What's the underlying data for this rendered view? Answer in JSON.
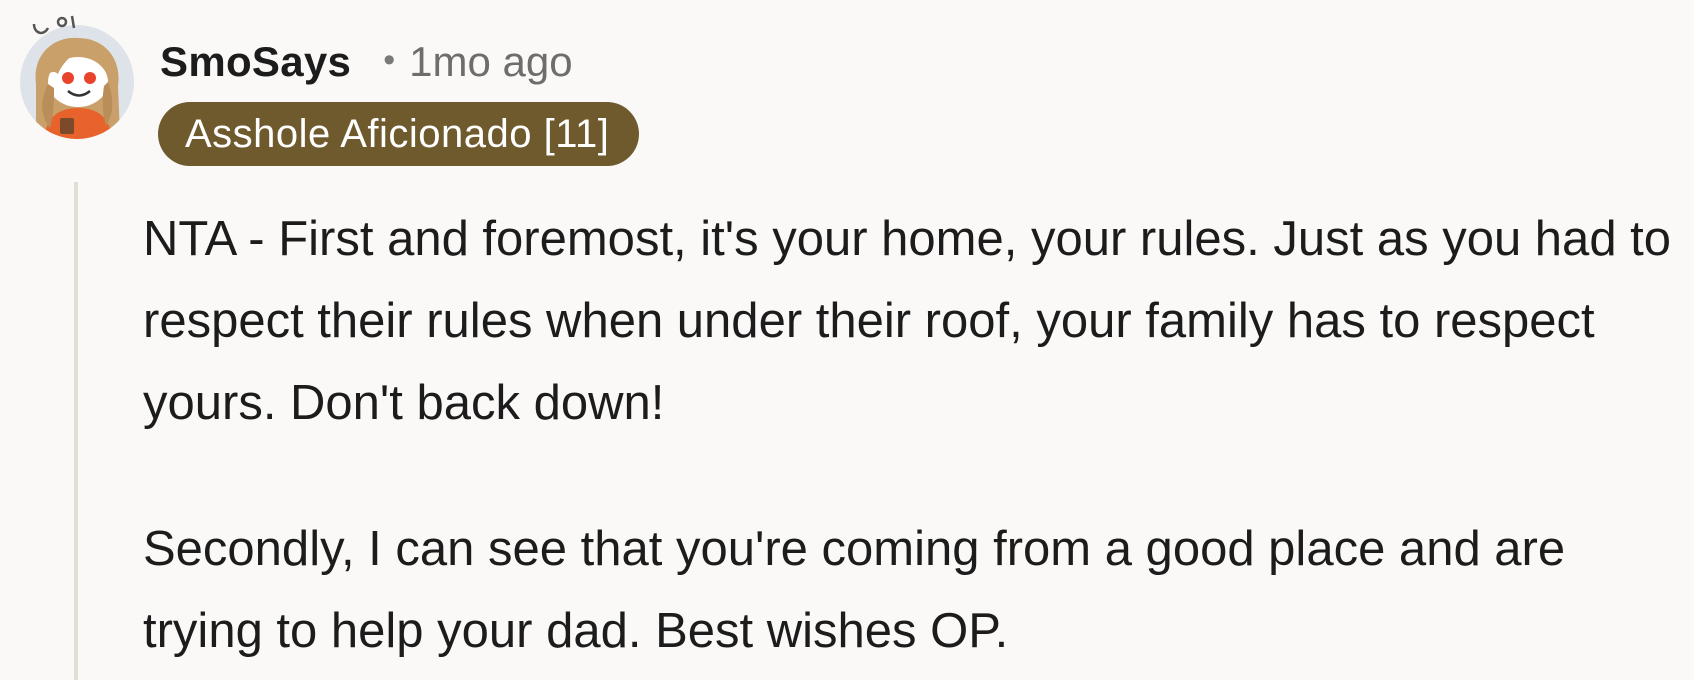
{
  "comment": {
    "author": "SmoSays",
    "separator": "•",
    "time_ago": "1mo ago",
    "flair": "Asshole Aficionado [11]",
    "avatar_icon": "snoo-avatar-icon",
    "paragraphs": [
      "NTA - First and foremost, it's your home, your rules. Just as you had to respect their rules when under their roof, your family has to respect yours. Don't back down!",
      "Secondly, I can see that you're coming from a good place and are trying to help your dad. Best wishes OP."
    ]
  },
  "colors": {
    "background": "#faf9f7",
    "flair_background": "#6e5a2d",
    "flair_text": "#ffffff",
    "thread_line": "#e3ddd8"
  }
}
